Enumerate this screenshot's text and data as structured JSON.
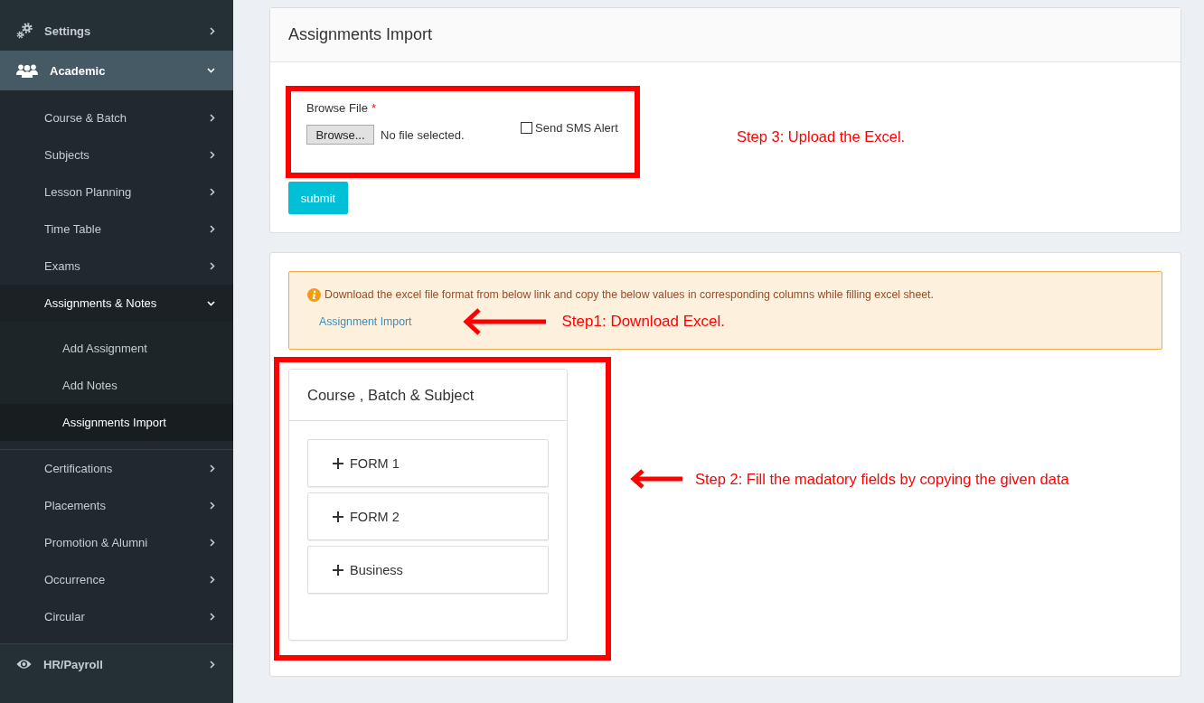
{
  "sidebar": {
    "items": [
      {
        "label": "Settings",
        "expanded": false
      },
      {
        "label": "Academic",
        "expanded": true,
        "children": [
          {
            "label": "Course & Batch",
            "expanded": false
          },
          {
            "label": "Subjects",
            "expanded": false
          },
          {
            "label": "Lesson Planning",
            "expanded": false
          },
          {
            "label": "Time Table",
            "expanded": false
          },
          {
            "label": "Exams",
            "expanded": false
          },
          {
            "label": "Assignments & Notes",
            "expanded": true,
            "children": [
              {
                "label": "Add Assignment",
                "selected": false
              },
              {
                "label": "Add Notes",
                "selected": false
              },
              {
                "label": "Assignments Import",
                "selected": true
              }
            ]
          },
          {
            "label": "Certifications",
            "expanded": false
          },
          {
            "label": "Placements",
            "expanded": false
          },
          {
            "label": "Promotion & Alumni",
            "expanded": false
          },
          {
            "label": "Occurrence",
            "expanded": false
          },
          {
            "label": "Circular",
            "expanded": false
          }
        ]
      },
      {
        "label": "HR/Payroll",
        "expanded": false
      }
    ]
  },
  "import_card": {
    "title": "Assignments Import",
    "file_field": {
      "label": "Browse File",
      "required_mark": "*",
      "button": "Browse...",
      "status": "No file selected."
    },
    "sms_alert": {
      "label": "Send SMS Alert",
      "checked": false
    },
    "submit": "submit",
    "annotation": {
      "text": "Step 3: Upload the Excel.",
      "arrow": false
    }
  },
  "format_card": {
    "alert": {
      "text": "Download the excel file format from below link and copy the below values in corresponding columns while filling excel sheet.",
      "link": "Assignment Import",
      "annotation": {
        "text": "Step1: Download Excel.",
        "arrow": true
      }
    },
    "panel": {
      "title": "Course , Batch & Subject",
      "items": [
        {
          "label": "FORM 1",
          "expanded": false
        },
        {
          "label": "FORM 2",
          "expanded": false
        },
        {
          "label": "Business",
          "expanded": false
        }
      ],
      "annotation": {
        "text": "Step 2: Fill the madatory fields by copying the given data",
        "arrow": true
      }
    }
  }
}
